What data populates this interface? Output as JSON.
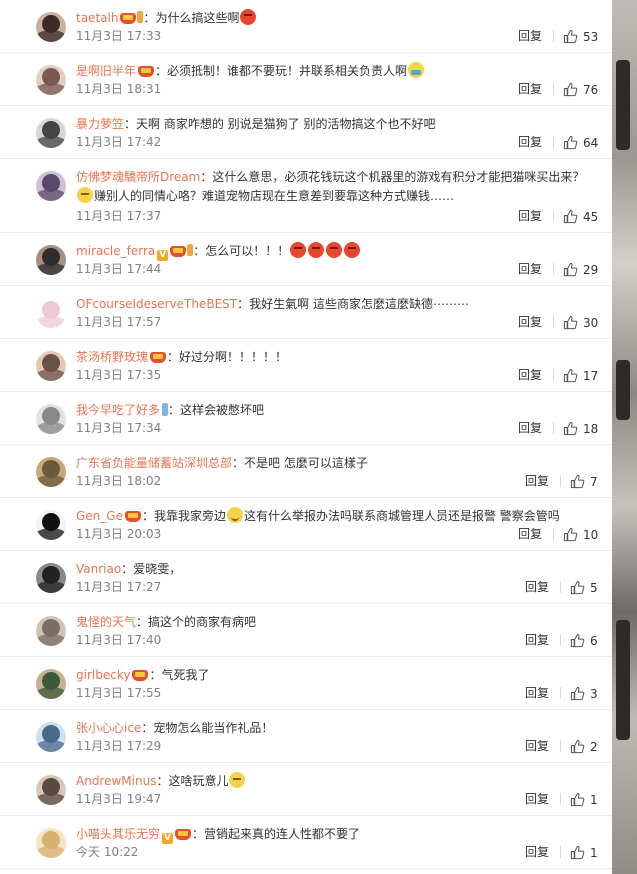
{
  "reply_label": "回复",
  "comments": [
    {
      "user": "taetalh",
      "badges": [
        "crown",
        "fans"
      ],
      "text": "：为什么搞这些啊",
      "emojis": [
        "angry"
      ],
      "time": "11月3日 17:33",
      "likes": "53"
    },
    {
      "user": "是啊旧半年",
      "badges": [
        "crown"
      ],
      "text": "：必须抵制！谁都不要玩！并联系相关负责人啊",
      "emojis": [
        "cry"
      ],
      "time": "11月3日 18:31",
      "likes": "76"
    },
    {
      "user": "暴力萝笠",
      "badges": [],
      "text": "：天啊 商家咋想的 别说是猫狗了 别的活物搞这个也不好吧",
      "emojis": [],
      "time": "11月3日 17:42",
      "likes": "64"
    },
    {
      "user": "仿佛梦魂驕帝所Dream",
      "badges": [],
      "text": "：这什么意思，必须花钱玩这个机器里的游戏有积分才能把猫咪买出来？",
      "lead_emoji": "think",
      "text2": "赚别人的同情心咯？难道宠物店现在生意差到要靠这种方式赚钱……",
      "emojis": [],
      "time": "11月3日 17:37",
      "likes": "45",
      "wrap": true
    },
    {
      "user": "miracle_ferra",
      "badges": [
        "v",
        "crown",
        "fans"
      ],
      "text": "：怎么可以！！！",
      "emojis": [
        "angry",
        "angry",
        "angry",
        "angry"
      ],
      "time": "11月3日 17:44",
      "likes": "29"
    },
    {
      "user": "OFcourseIdeserveTheBEST",
      "badges": [],
      "text": "：我好生氣啊 這些商家怎麼這麼缺德⋯⋯⋯",
      "emojis": [],
      "time": "11月3日 17:57",
      "likes": "30"
    },
    {
      "user": "茶汤桥野玫瑰",
      "badges": [
        "crown"
      ],
      "text": "：好过分啊！！！！！",
      "emojis": [],
      "time": "11月3日 17:35",
      "likes": "17"
    },
    {
      "user": "我今早吃了好多",
      "badges": [
        "fansblue"
      ],
      "text": "：这样会被憋坏吧",
      "emojis": [],
      "time": "11月3日 17:34",
      "likes": "18"
    },
    {
      "user": "广东省负能量储蓄站深圳总部",
      "badges": [],
      "text": "：不是吧 怎麼可以這樣子",
      "emojis": [],
      "time": "11月3日 18:02",
      "likes": "7"
    },
    {
      "user": "Gen_Ge",
      "badges": [
        "crown"
      ],
      "text": "：我靠我家旁边",
      "emojis": [
        "smile"
      ],
      "text_after": "这有什么举报办法吗联系商城管理人员还是报警 警察会管吗",
      "time": "11月3日 20:03",
      "likes": "10"
    },
    {
      "user": "Vanriao",
      "badges": [],
      "text": "：爱晓雯，",
      "emojis": [],
      "time": "11月3日 17:27",
      "likes": "5"
    },
    {
      "user": "鬼怪的天气",
      "badges": [],
      "text": "：搞这个的商家有病吧",
      "emojis": [],
      "time": "11月3日 17:40",
      "likes": "6"
    },
    {
      "user": "girlbecky",
      "badges": [
        "crown"
      ],
      "text": "：气死我了",
      "emojis": [],
      "time": "11月3日 17:55",
      "likes": "3"
    },
    {
      "user": "张小心心ice",
      "badges": [],
      "text": "：宠物怎么能当作礼品！",
      "emojis": [],
      "time": "11月3日 17:29",
      "likes": "2"
    },
    {
      "user": "AndrewMinus",
      "badges": [],
      "text": "：这啥玩意儿",
      "emojis": [
        "think"
      ],
      "time": "11月3日 19:47",
      "likes": "1"
    },
    {
      "user": "小喵头其乐无穷",
      "badges": [
        "v",
        "crown"
      ],
      "text": "：营销起来真的连人性都不要了",
      "emojis": [],
      "time": "今天 10:22",
      "likes": "1"
    }
  ],
  "colors": {
    "username": "#eb7350",
    "time": "#808080",
    "divider": "#ececec"
  },
  "icons": {
    "like": "thumbs-up-icon",
    "crown": "member-crown-icon",
    "vip": "verified-v-icon"
  }
}
